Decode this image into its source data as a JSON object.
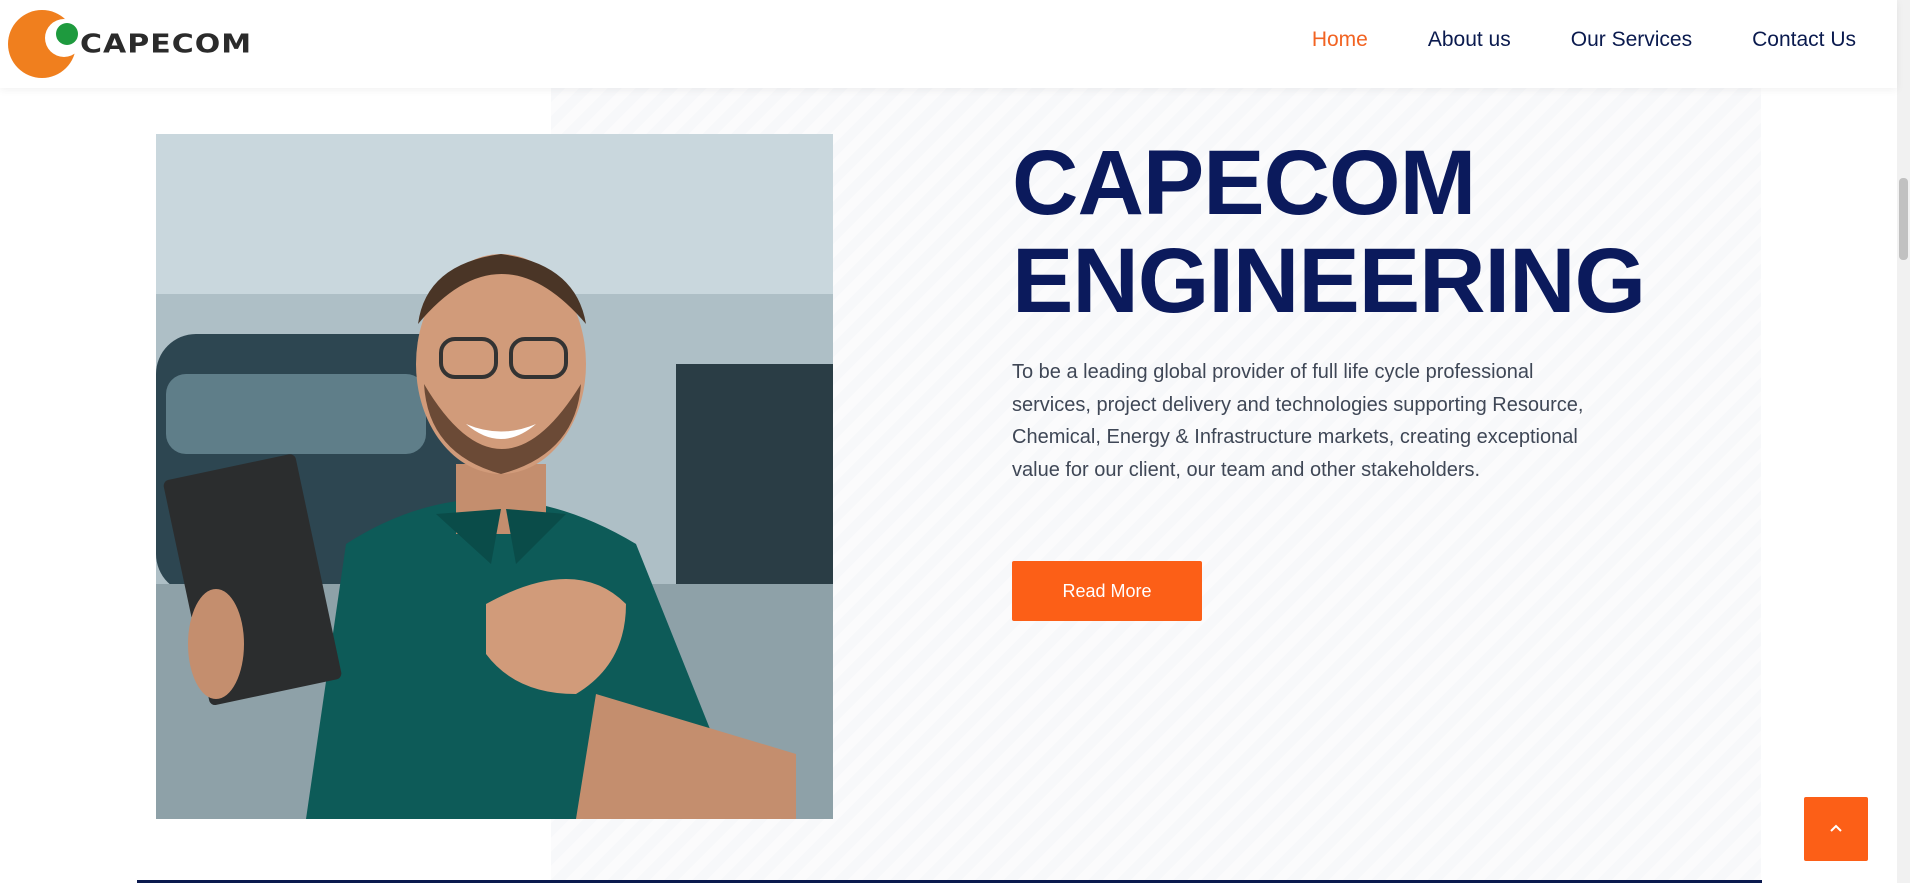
{
  "brand": {
    "name": "CAPECOM",
    "colors": {
      "orange": "#f26322",
      "green": "#1e9a3e",
      "navy": "#0b1a5c"
    }
  },
  "nav": {
    "items": [
      {
        "label": "Home",
        "active": true
      },
      {
        "label": "About us",
        "active": false
      },
      {
        "label": "Our Services",
        "active": false
      },
      {
        "label": "Contact Us",
        "active": false
      }
    ]
  },
  "hero": {
    "title_line1": "CAPECOM",
    "title_line2": "ENGINEERING",
    "description": "To be a leading global provider of full life cycle professional services, project delivery and technologies supporting Resource, Chemical, Energy & Infrastructure markets, creating exceptional value for our client, our team and other stakeholders.",
    "button_label": "Read More",
    "image": "smiling man in teal polo shirt holding a black folder in a car showroom"
  },
  "back_to_top": {
    "icon": "chevron-up-icon"
  }
}
